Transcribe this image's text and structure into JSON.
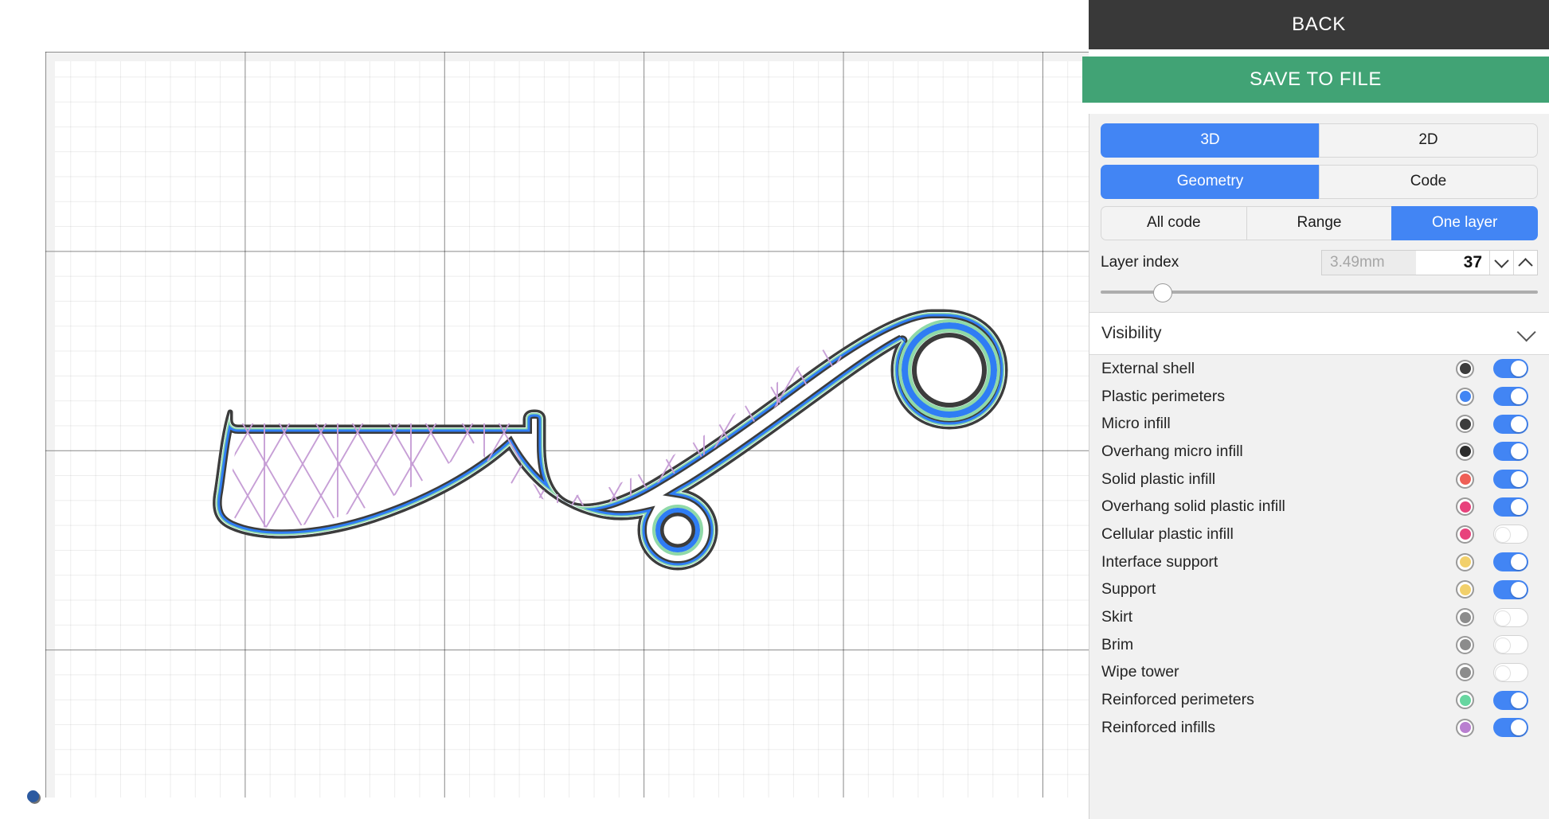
{
  "header": {
    "back_label": "BACK",
    "save_label": "SAVE TO FILE"
  },
  "view_tabs": {
    "dimension": [
      {
        "label": "3D",
        "active": true
      },
      {
        "label": "2D",
        "active": false
      }
    ],
    "mode": [
      {
        "label": "Geometry",
        "active": true
      },
      {
        "label": "Code",
        "active": false
      }
    ],
    "range": [
      {
        "label": "All code",
        "active": false
      },
      {
        "label": "Range",
        "active": false
      },
      {
        "label": "One layer",
        "active": true
      }
    ]
  },
  "layer": {
    "label": "Layer index",
    "height_value": "3.49mm",
    "index_value": "37",
    "slider_percent": 14
  },
  "visibility": {
    "title": "Visibility",
    "items": [
      {
        "label": "External shell",
        "color": "#3c3c3c",
        "on": true
      },
      {
        "label": "Plastic perimeters",
        "color": "#4285f4",
        "on": true
      },
      {
        "label": "Micro infill",
        "color": "#3c3c3c",
        "on": true
      },
      {
        "label": "Overhang micro infill",
        "color": "#2d2d2d",
        "on": true
      },
      {
        "label": "Solid plastic infill",
        "color": "#ef5f56",
        "on": true
      },
      {
        "label": "Overhang solid plastic infill",
        "color": "#e8427c",
        "on": true
      },
      {
        "label": "Cellular plastic infill",
        "color": "#e8427c",
        "on": false
      },
      {
        "label": "Interface support",
        "color": "#f2d06b",
        "on": true
      },
      {
        "label": "Support",
        "color": "#f2d06b",
        "on": true
      },
      {
        "label": "Skirt",
        "color": "#8c8c8c",
        "on": false
      },
      {
        "label": "Brim",
        "color": "#8c8c8c",
        "on": false
      },
      {
        "label": "Wipe tower",
        "color": "#8c8c8c",
        "on": false
      },
      {
        "label": "Reinforced perimeters",
        "color": "#67d6a0",
        "on": true
      },
      {
        "label": "Reinforced infills",
        "color": "#b97fd0",
        "on": true
      }
    ]
  },
  "viewport": {
    "plate_label": "build-plate-grid",
    "origin_label": "origin-marker",
    "model": {
      "name": "karambit-knife-layer-preview",
      "external_shell_color": "#3c3c3c",
      "perimeter_color": "#2f7df4",
      "reinforced_perimeter_color": "#8fd9a8",
      "infill_color": "#c79fd6"
    }
  }
}
